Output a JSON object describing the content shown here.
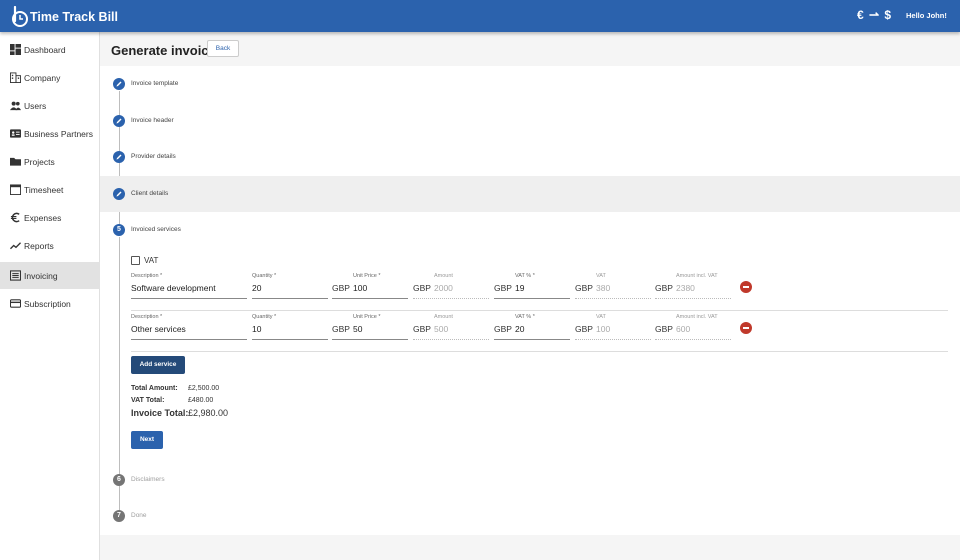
{
  "app": {
    "title": "Time Track Bill",
    "currency_symbols": "€ ⇀ $",
    "greeting": "Hello John!"
  },
  "sidebar": {
    "items": [
      {
        "label": "Dashboard",
        "icon": "dashboard-icon"
      },
      {
        "label": "Company",
        "icon": "company-icon"
      },
      {
        "label": "Users",
        "icon": "users-icon"
      },
      {
        "label": "Business Partners",
        "icon": "business-partners-icon"
      },
      {
        "label": "Projects",
        "icon": "folder-icon"
      },
      {
        "label": "Timesheet",
        "icon": "calendar-icon"
      },
      {
        "label": "Expenses",
        "icon": "euro-icon"
      },
      {
        "label": "Reports",
        "icon": "trending-icon"
      },
      {
        "label": "Invoicing",
        "icon": "invoice-icon",
        "active": true
      },
      {
        "label": "Subscription",
        "icon": "credit-card-icon"
      }
    ]
  },
  "page": {
    "title": "Generate invoice",
    "back_label": "Back"
  },
  "steps": [
    {
      "label": "Invoice template",
      "state": "done"
    },
    {
      "label": "Invoice header",
      "state": "done"
    },
    {
      "label": "Provider details",
      "state": "done"
    },
    {
      "label": "Client details",
      "state": "done"
    },
    {
      "number": "5",
      "label": "Invoiced services",
      "state": "active"
    },
    {
      "number": "6",
      "label": "Disclaimers",
      "state": "pending"
    },
    {
      "number": "7",
      "label": "Done",
      "state": "pending"
    }
  ],
  "vat": {
    "label": "VAT",
    "checked": false
  },
  "columns": {
    "description": "Description *",
    "quantity": "Quantity *",
    "unit_price": "Unit Price *",
    "amount": "Amount",
    "vat_pct": "VAT % *",
    "vat": "VAT",
    "amount_incl_vat": "Amount incl. VAT"
  },
  "currency": "GBP",
  "services": [
    {
      "description": "Software development",
      "quantity": "20",
      "unit_price": "100",
      "amount": "2000",
      "vat_pct": "19",
      "vat": "380",
      "amount_incl_vat": "2380"
    },
    {
      "description": "Other services",
      "quantity": "10",
      "unit_price": "50",
      "amount": "500",
      "vat_pct": "20",
      "vat": "100",
      "amount_incl_vat": "600"
    }
  ],
  "add_service_label": "Add service",
  "totals": {
    "total_amount_label": "Total Amount:",
    "total_amount": "£2,500.00",
    "vat_total_label": "VAT Total:",
    "vat_total": "£480.00",
    "invoice_total_label": "Invoice Total:",
    "invoice_total": "£2,980.00"
  },
  "next_label": "Next",
  "colors": {
    "primary": "#2b62ad",
    "add_button": "#244a79",
    "remove": "#c0392b"
  }
}
